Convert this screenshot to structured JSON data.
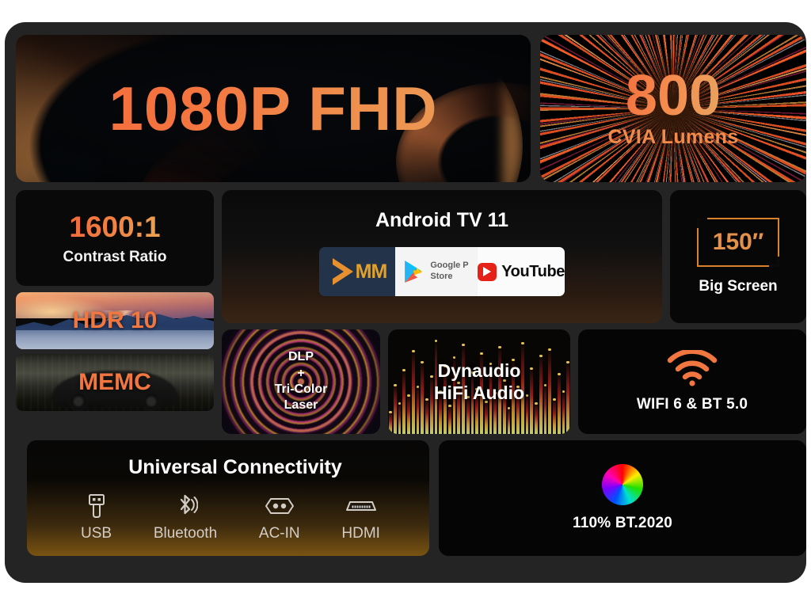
{
  "hero": {
    "title": "1080P FHD"
  },
  "lumens": {
    "value": "800",
    "label": "CVIA Lumens"
  },
  "contrast": {
    "value": "1600:1",
    "label": "Contrast Ratio"
  },
  "hdr": {
    "label": "HDR 10"
  },
  "memc": {
    "label": "MEMC"
  },
  "android_tv": {
    "title": "Android TV 11",
    "apps": [
      {
        "name": "MX Player",
        "word": "MM"
      },
      {
        "name": "Google Play Store",
        "line1": "Google P",
        "line2": "Store"
      },
      {
        "name": "YouTube",
        "word": "YouTube"
      }
    ]
  },
  "big_screen": {
    "size": "150″",
    "label": "Big Screen"
  },
  "dlp": {
    "line1": "DLP",
    "line2": "+",
    "line3": "Tri-Color",
    "line4": "Laser"
  },
  "dynaudio": {
    "line1": "Dynaudio",
    "line2": "HiFi Audio"
  },
  "wifi": {
    "label": "WIFI 6 & BT 5.0"
  },
  "connectivity": {
    "title": "Universal Connectivity",
    "ports": [
      {
        "icon": "usb-icon",
        "label": "USB"
      },
      {
        "icon": "bluetooth-icon",
        "label": "Bluetooth"
      },
      {
        "icon": "ac-in-icon",
        "label": "AC-IN"
      },
      {
        "icon": "hdmi-icon",
        "label": "HDMI"
      }
    ]
  },
  "color_gamut": {
    "label": "110% BT.2020"
  },
  "colors": {
    "accent_orange": "#f2763f",
    "accent_amber": "#e8a458",
    "frame": "#242424",
    "panel": "#0a0a0a",
    "text_light": "#ffffff"
  }
}
